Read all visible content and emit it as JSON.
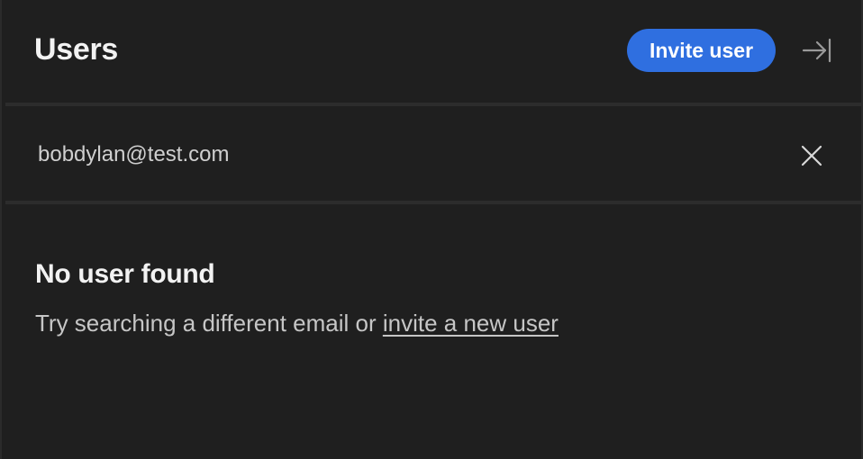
{
  "header": {
    "title": "Users",
    "invite_button_label": "Invite user",
    "collapse_icon": "collapse-panel-icon"
  },
  "search": {
    "value": "bobdylan@test.com",
    "clear_icon": "close-icon"
  },
  "empty_state": {
    "title": "No user found",
    "message_prefix": "Try searching a different email or ",
    "link_label": "invite a new user"
  },
  "colors": {
    "background": "#1f1f1f",
    "accent": "#2f6fe0",
    "divider": "#2c2c2c",
    "text_primary": "#f2f2f2",
    "text_secondary": "#c6c6c6"
  }
}
